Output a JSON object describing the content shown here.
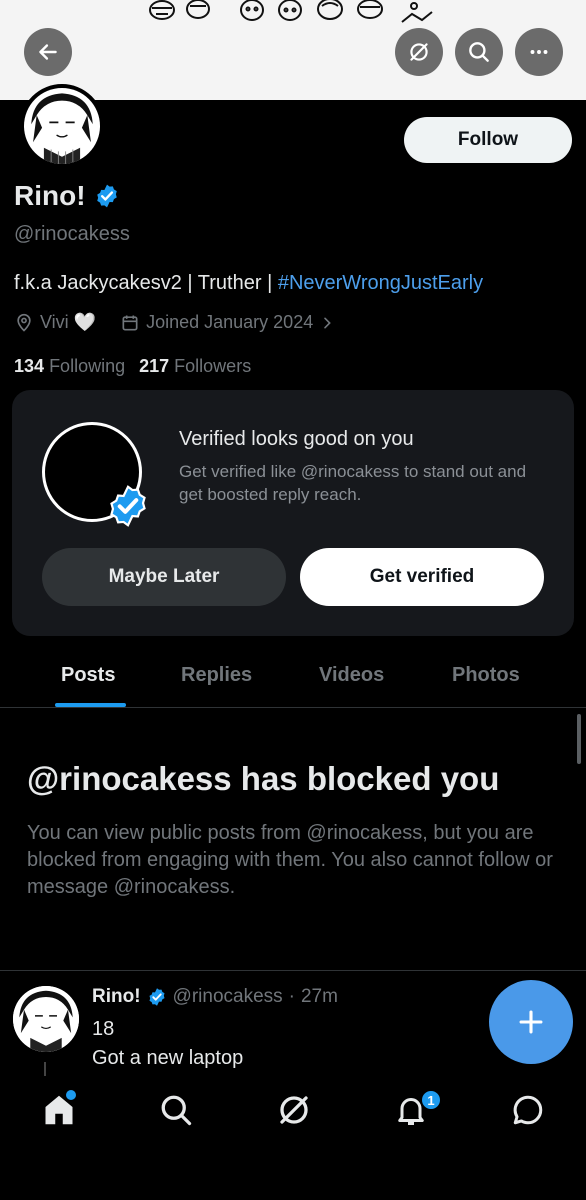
{
  "header": {
    "back_icon": "arrow-left-icon",
    "grok_icon": "grok-icon",
    "search_icon": "search-icon",
    "more_icon": "more-horizontal-icon"
  },
  "profile": {
    "follow_label": "Follow",
    "display_name": "Rino!",
    "handle": "@rinocakess",
    "bio_text": "f.k.a Jackycakesv2 | Truther | ",
    "bio_hashtag": "#NeverWrongJustEarly",
    "location": "Vivi 🤍",
    "joined": "Joined January 2024",
    "following_count": "134",
    "following_label": "Following",
    "followers_count": "217",
    "followers_label": "Followers"
  },
  "verified_card": {
    "title": "Verified looks good on you",
    "description": "Get verified like @rinocakess to stand out and get boosted reply reach.",
    "maybe_label": "Maybe Later",
    "get_verified_label": "Get verified"
  },
  "tabs": [
    {
      "label": "Posts",
      "active": true
    },
    {
      "label": "Replies",
      "active": false
    },
    {
      "label": "Videos",
      "active": false
    },
    {
      "label": "Photos",
      "active": false
    }
  ],
  "blocked": {
    "title": "@rinocakess has blocked you",
    "description": "You can view public posts from @rinocakess, but you are blocked from engaging with them. You also cannot follow or message @rinocakess."
  },
  "post": {
    "name": "Rino!",
    "handle": "@rinocakess",
    "separator": "·",
    "time": "27m",
    "line1": "18",
    "line2": "Got a new laptop"
  },
  "bottom_nav": {
    "notifications_badge": "1",
    "items": [
      "home-icon",
      "search-icon",
      "grok-icon",
      "notifications-icon",
      "messages-icon"
    ]
  },
  "colors": {
    "accent": "#1d9bf0",
    "hashtag": "#4d9fec",
    "fab": "#4a99e9",
    "muted": "#71767b"
  }
}
